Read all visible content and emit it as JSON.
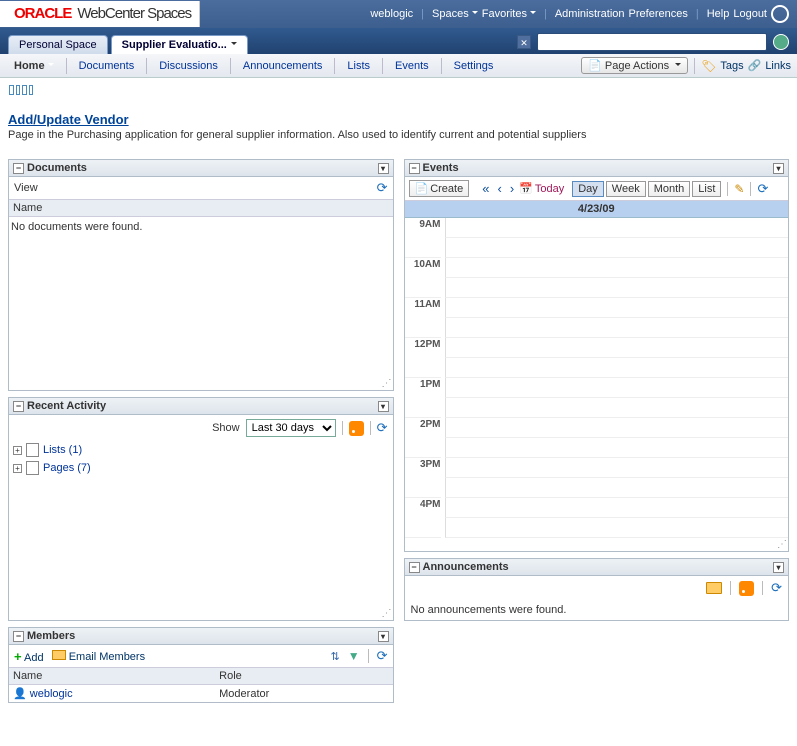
{
  "header": {
    "brand": "ORACLE",
    "product": "WebCenter Spaces",
    "user": "weblogic",
    "menus": {
      "spaces": "Spaces",
      "favorites": "Favorites"
    },
    "links": {
      "admin": "Administration",
      "prefs": "Preferences",
      "help": "Help",
      "logout": "Logout"
    }
  },
  "tabs": {
    "personal": "Personal Space",
    "supplier": "Supplier Evaluatio..."
  },
  "toolbar": {
    "home": "Home",
    "documents": "Documents",
    "discussions": "Discussions",
    "announcements": "Announcements",
    "lists": "Lists",
    "events": "Events",
    "settings": "Settings",
    "page_actions": "Page Actions",
    "tags": "Tags",
    "links": "Links"
  },
  "page": {
    "title": "Add/Update Vendor",
    "desc": "Page in the Purchasing application for general supplier information. Also used to identify current and potential suppliers"
  },
  "documents": {
    "title": "Documents",
    "view": "View",
    "col_name": "Name",
    "empty": "No documents were found."
  },
  "activity": {
    "title": "Recent Activity",
    "show": "Show",
    "range": "Last 30 days",
    "items": [
      {
        "label": "Lists (1)"
      },
      {
        "label": "Pages (7)"
      }
    ]
  },
  "members": {
    "title": "Members",
    "add": "Add",
    "email": "Email Members",
    "col_name": "Name",
    "col_role": "Role",
    "rows": [
      {
        "name": "weblogic",
        "role": "Moderator"
      }
    ]
  },
  "events": {
    "title": "Events",
    "create": "Create",
    "today": "Today",
    "views": {
      "day": "Day",
      "week": "Week",
      "month": "Month",
      "list": "List"
    },
    "date": "4/23/09",
    "hours": [
      "9AM",
      "10AM",
      "11AM",
      "12PM",
      "1PM",
      "2PM",
      "3PM",
      "4PM"
    ]
  },
  "announcements": {
    "title": "Announcements",
    "empty": "No announcements were found."
  }
}
